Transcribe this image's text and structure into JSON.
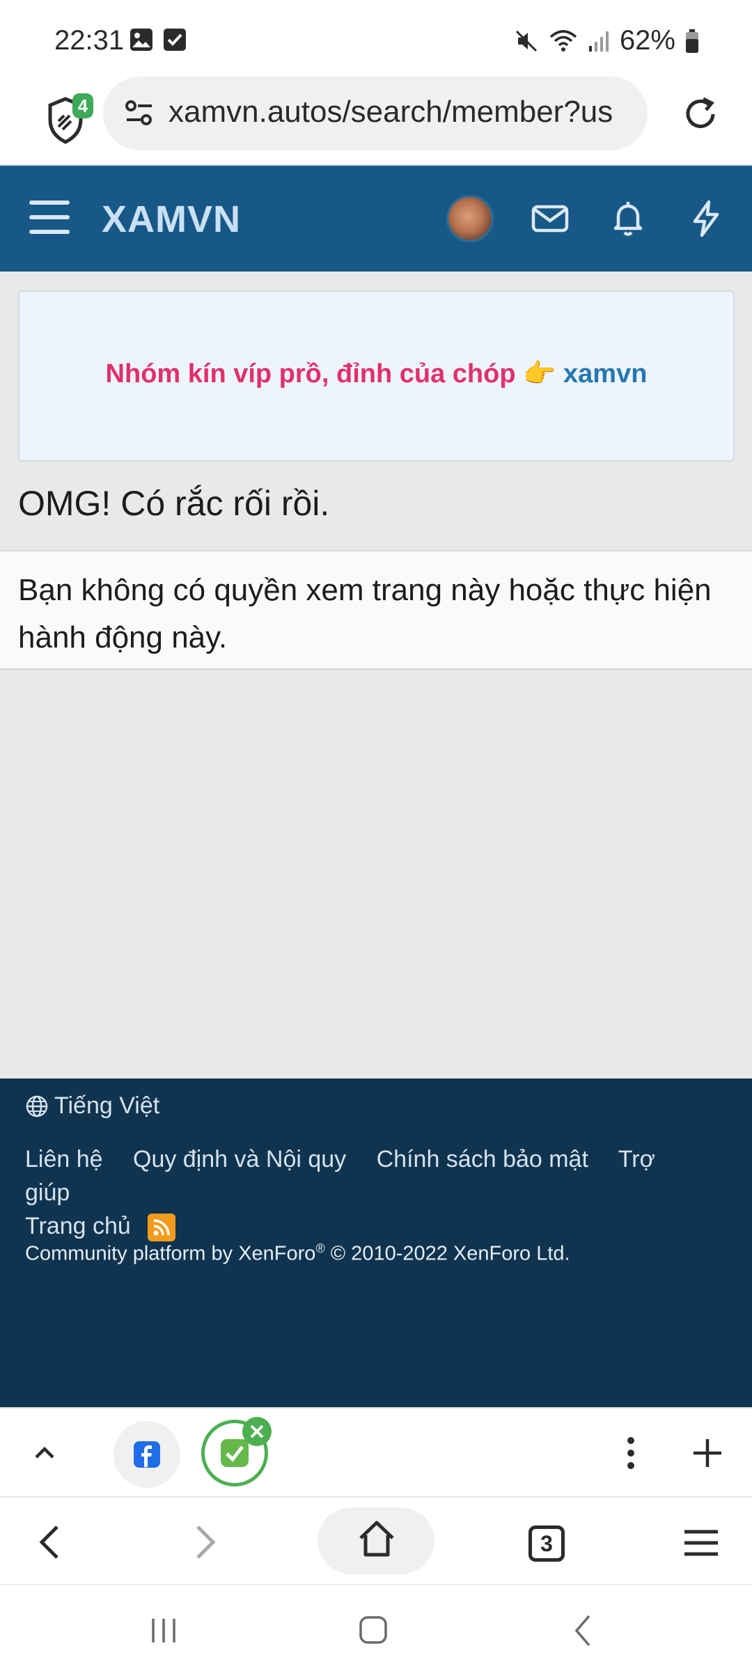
{
  "status_bar": {
    "time": "22:31",
    "battery_text": "62%",
    "icons_left": [
      "gallery-icon",
      "checkbox-icon"
    ],
    "icons_right": [
      "mute-icon",
      "wifi-icon",
      "signal-icon",
      "battery-icon"
    ]
  },
  "browser": {
    "shield_badge": "4",
    "url": "xamvn.autos/search/member?us",
    "tabs_count": "3"
  },
  "site": {
    "logo": "XAMVN",
    "notice": {
      "pink_text": "Nhóm kín víp prồ, đỉnh của chóp",
      "emoji": "👉",
      "blue_text": "xamvn"
    },
    "error_title": "OMG! Có rắc rối rồi.",
    "error_message": "Bạn không có quyền xem trang này hoặc thực hiện hành động này."
  },
  "footer": {
    "language": "Tiếng Việt",
    "links": [
      "Liên hệ",
      "Quy định và Nội quy",
      "Chính sách bảo mật",
      "Trợ giúp",
      "Trang chủ"
    ],
    "copyright_pre": "Community platform by XenForo",
    "copyright_reg": "®",
    "copyright_post": " © 2010-2022 XenForo Ltd."
  },
  "colors": {
    "header_bg": "#185886",
    "footer_bg": "#10344f",
    "notice_pink": "#e0306a",
    "notice_blue": "#2577b1"
  }
}
